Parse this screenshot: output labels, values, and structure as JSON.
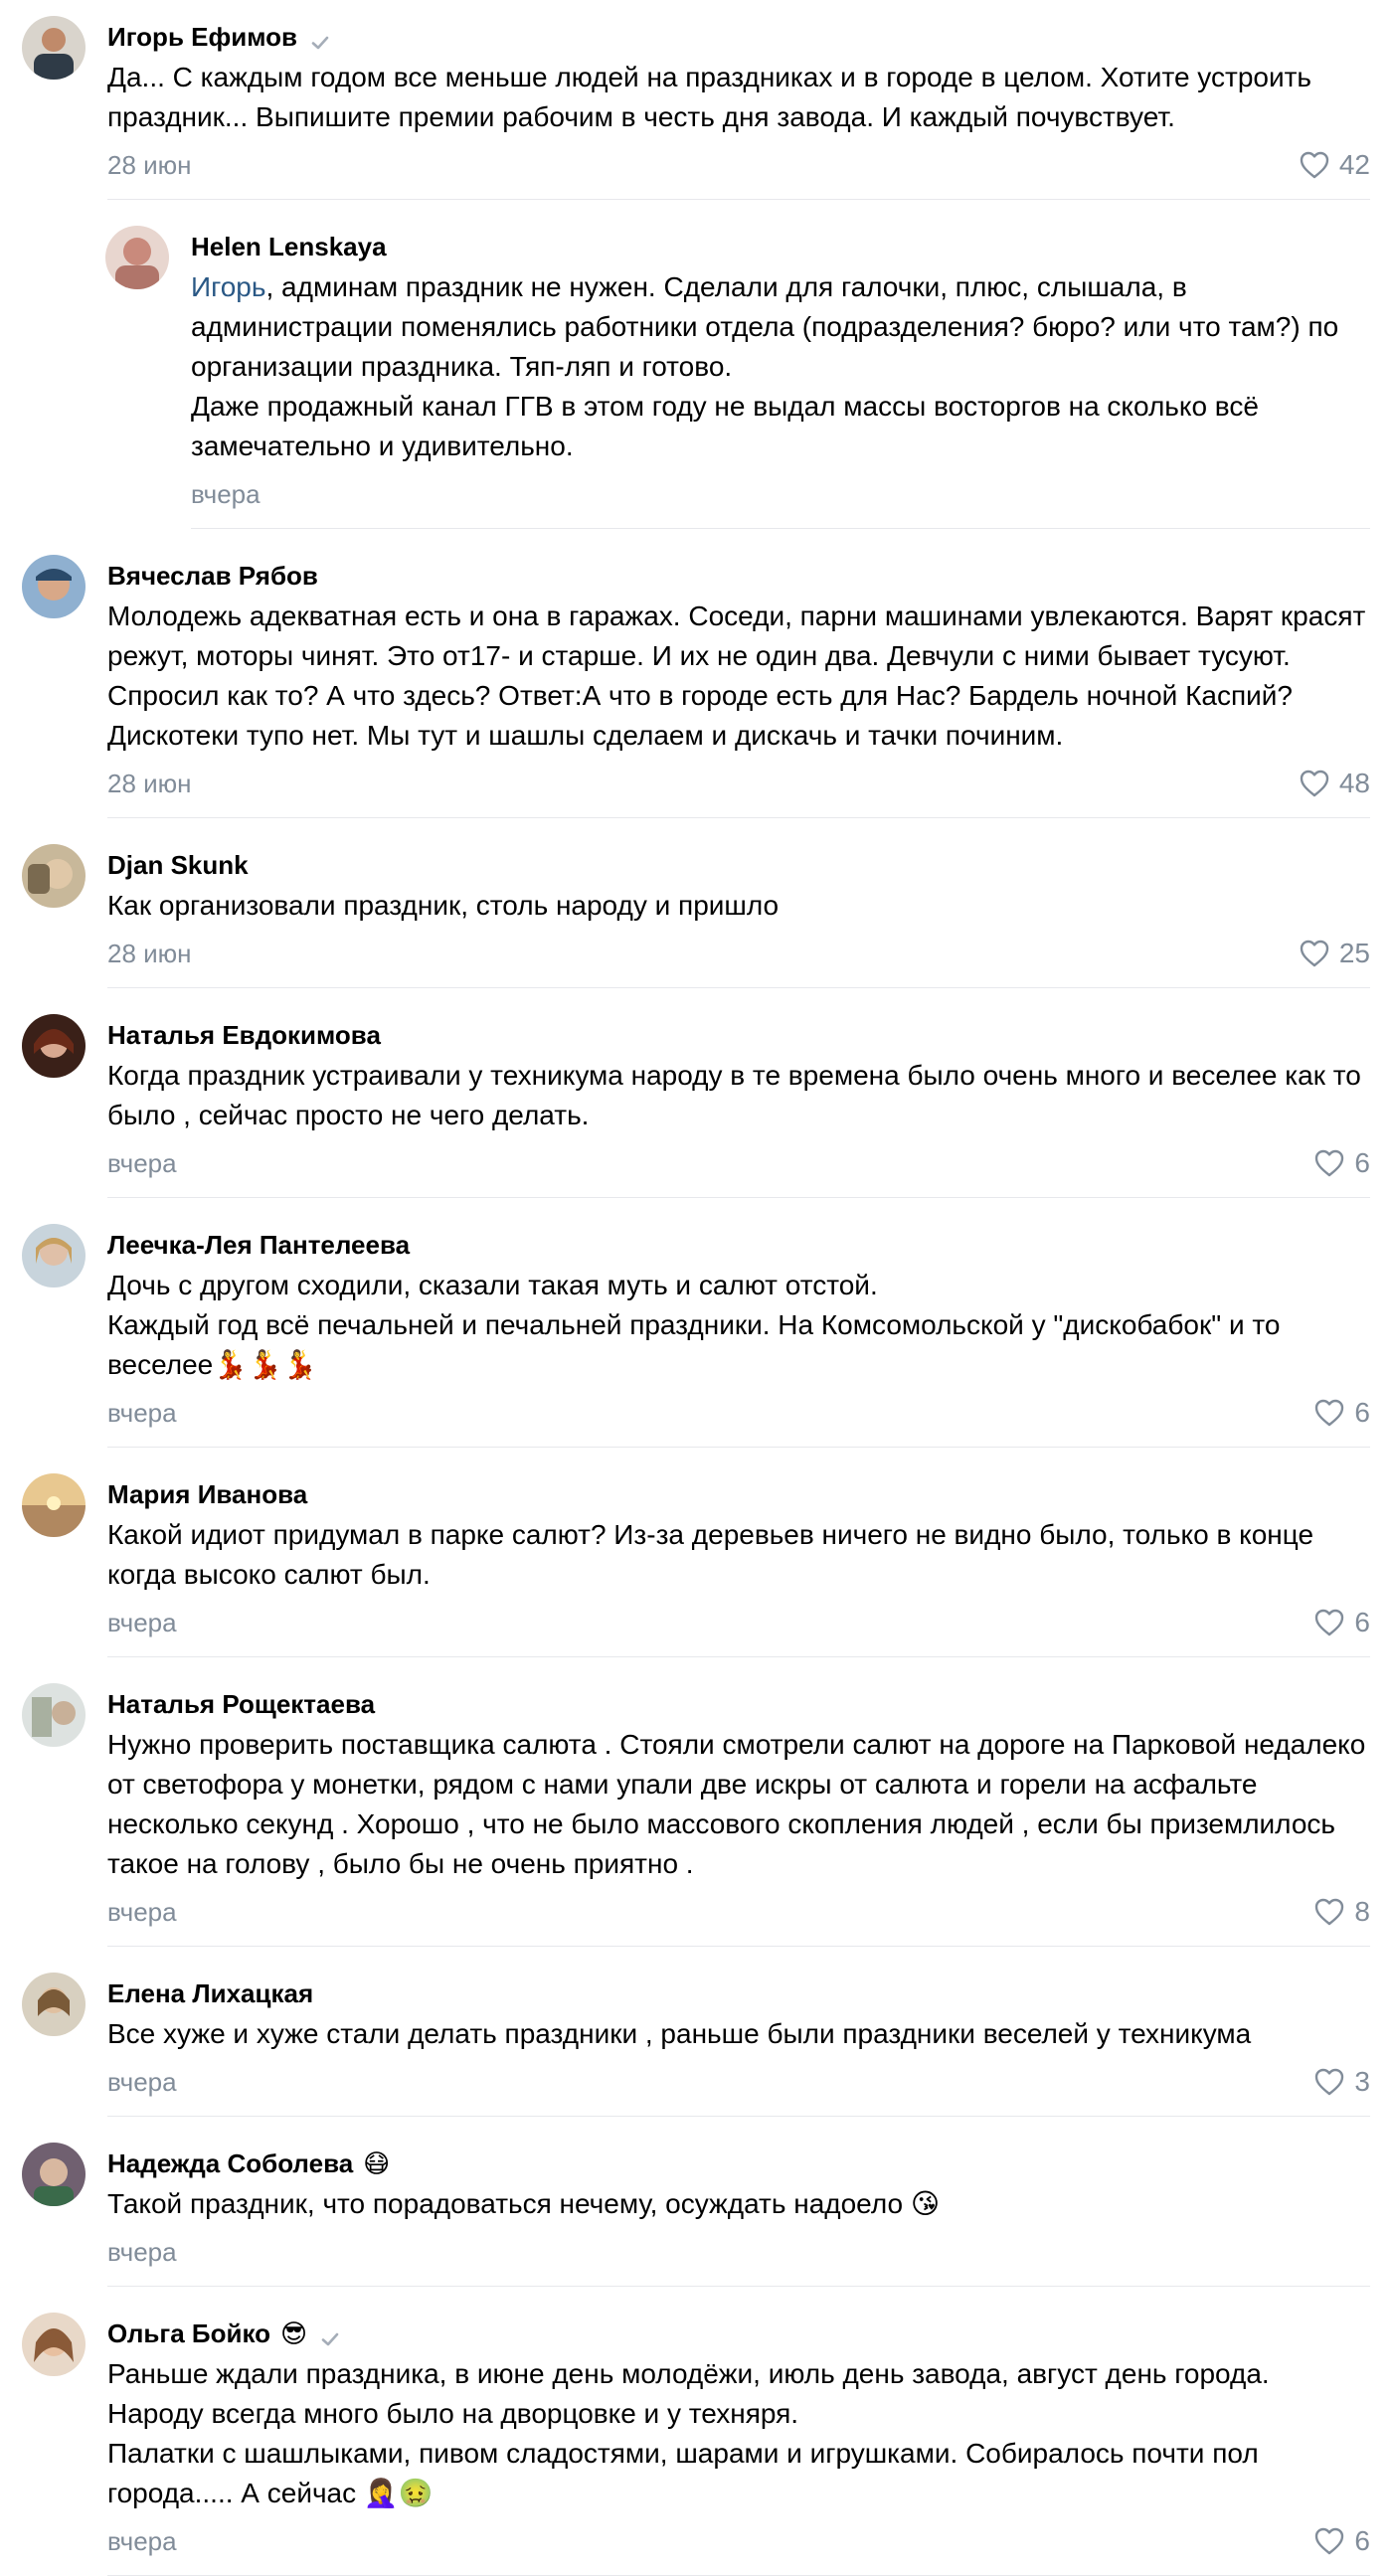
{
  "comments": [
    {
      "author": "Игорь Ефимов",
      "verified": true,
      "text": "Да... С каждым годом все меньше людей на праздниках и в городе в целом. Хотите устроить праздник... Выпишите премии рабочим в честь дня завода. И каждый почувствует.",
      "date": "28 июн",
      "likes": "42",
      "avatar_color": "#3b4a5a"
    },
    {
      "author": "Helen Lenskaya",
      "mention": "Игорь",
      "text": ", админам праздник не нужен. Сделали для галочки, плюс, слышала, в администрации поменялись работники отдела (подразделения? бюро? или что там?) по организации праздника. Тяп-ляп и готово.\nДаже продажный канал ГГВ в этом году не выдал массы восторгов на сколько всё замечательно и удивительно.",
      "date": "вчера",
      "avatar_color": "#c98a7c"
    },
    {
      "author": "Вячеслав Рябов",
      "text": "Молодежь адекватная есть и она в гаражах. Соседи, парни машинами увлекаются. Варят красят режут, моторы чинят. Это от17- и старше. И их не один два. Девчули с ними бывает тусуют. Спросил как то? А что здесь? Ответ:А что в городе есть для Нас? Бардель ночной Каспий? Дискотеки тупо нет. Мы тут и шашлы сделаем и дискачь и тачки починим.",
      "date": "28 июн",
      "likes": "48",
      "avatar_color": "#4a6a8a"
    },
    {
      "author": "Djan Skunk",
      "text": "Как организовали праздник, столь народу и пришло",
      "date": "28 июн",
      "likes": "25",
      "avatar_color": "#8a7a60"
    },
    {
      "author": "Наталья Евдокимова",
      "text": "Когда праздник устраивали у техникума народу в те времена было очень много и веселее как то было , сейчас просто не чего делать.",
      "date": "вчера",
      "likes": "6",
      "avatar_color": "#6a3020"
    },
    {
      "author": "Леечка-Лея Пантелеева",
      "text": "Дочь с другом сходили, сказали такая муть и салют отстой.\nКаждый год всё печальней и печальней праздники. На Комсомольской у \"дискобабок\" и то веселее💃💃💃",
      "date": "вчера",
      "likes": "6",
      "avatar_color": "#9aa8b0"
    },
    {
      "author": "Мария Иванова",
      "text": "Какой идиот придумал в парке салют? Из-за деревьев ничего не видно было, только в конце когда высоко салют был.",
      "date": "вчера",
      "likes": "6",
      "avatar_color": "#c8a070"
    },
    {
      "author": "Наталья Рощектаева",
      "text": "Нужно проверить поставщика салюта . Стояли смотрели салют на дороге на Парковой недалеко от светофора у монетки, рядом с нами упали две искры от салюта и горели на асфальте несколько секунд . Хорошо , что не было массового скопления людей , если бы приземлилось такое на голову , было бы не очень приятно .",
      "date": "вчера",
      "likes": "8",
      "avatar_color": "#9aa090"
    },
    {
      "author": "Елена Лихацкая",
      "text": "Все хуже и хуже стали делать праздники , раньше были праздники веселей у техникума",
      "date": "вчера",
      "likes": "3",
      "avatar_color": "#a89070"
    },
    {
      "author": "Надежда Соболева",
      "author_emoji": "😷",
      "text": "Такой праздник, что порадоваться нечему, осуждать надоело 😘",
      "date": "вчера",
      "avatar_color": "#5a4a60"
    },
    {
      "author": "Ольга Бойко",
      "author_emoji": "😎",
      "verified": true,
      "text": "Раньше ждали праздника, в июне день молодёжи, июль день завода, август день города. Народу всегда много было на дворцовке и у техняря.\nПалатки с шашлыками, пивом сладостями, шарами и игрушками. Собиралось почти пол города..... А сейчас 🤦‍♀️🤢",
      "date": "вчера",
      "likes": "6",
      "avatar_color": "#b08060"
    }
  ]
}
